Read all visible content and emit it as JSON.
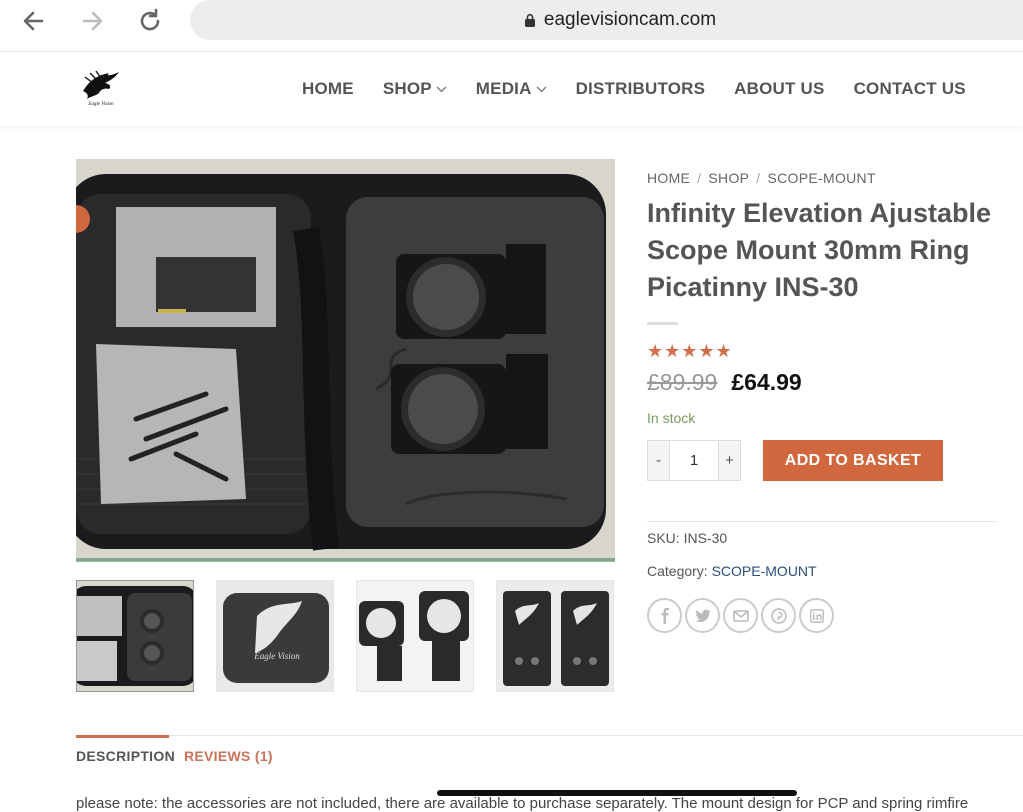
{
  "browser": {
    "url": "eaglevisioncam.com",
    "back_icon": "arrow-left-icon",
    "forward_icon": "arrow-right-icon",
    "reload_icon": "reload-icon"
  },
  "header": {
    "logo_icon": "eagle-vision-logo",
    "menu": [
      {
        "label": "HOME",
        "dropdown": false
      },
      {
        "label": "SHOP",
        "dropdown": true
      },
      {
        "label": "MEDIA",
        "dropdown": true
      },
      {
        "label": "DISTRIBUTORS",
        "dropdown": false
      },
      {
        "label": "ABOUT US",
        "dropdown": false
      },
      {
        "label": "CONTACT US",
        "dropdown": false
      }
    ]
  },
  "breadcrumb": [
    "HOME",
    "SHOP",
    "SCOPE-MOUNT"
  ],
  "product": {
    "title": "Infinity Elevation Ajustable Scope Mount 30mm Ring Picatinny INS-30",
    "rating_stars": "★★★★★",
    "rating_value": 5,
    "price_old": "£89.99",
    "price_new": "£64.99",
    "stock": "In stock",
    "qty_minus": "-",
    "qty_value": "1",
    "qty_plus": "+",
    "add_to_basket": "ADD TO BASKET",
    "sku_label": "SKU:",
    "sku_value": "INS-30",
    "category_label": "Category:",
    "category_value": "SCOPE-MOUNT",
    "share_icons": [
      "facebook-icon",
      "twitter-icon",
      "email-icon",
      "pinterest-icon",
      "linkedin-icon"
    ]
  },
  "tabs": {
    "description": "DESCRIPTION",
    "reviews": "REVIEWS (1)"
  },
  "description_snippet": "please note: the accessories are not included, there are available to purchase separately. The mount design for PCP and spring rimfire"
}
